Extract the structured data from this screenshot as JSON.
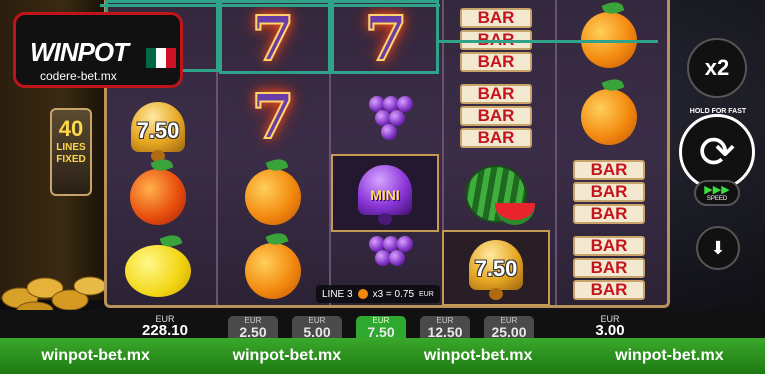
{
  "logo": {
    "brand": "WINPOT",
    "url": "codere-bet.mx",
    "flag_colors": [
      "#006847",
      "#ffffff",
      "#ce1126"
    ]
  },
  "lines": {
    "count": "40",
    "label1": "LINES",
    "label2": "FIXED"
  },
  "reels": [
    [
      "seven-symbol",
      "bell-symbol",
      "orange-symbol",
      "lemon-symbol"
    ],
    [
      "seven-symbol",
      "seven-symbol",
      "orange-symbol",
      "orange-symbol"
    ],
    [
      "seven-symbol",
      "grapes-symbol",
      "mini-bell-symbol",
      "grapes-symbol"
    ],
    [
      "bar-symbol",
      "bar-symbol",
      "watermelon-symbol",
      "bell-symbol"
    ],
    [
      "orange-symbol",
      "orange-symbol",
      "bar-symbol",
      "bar-symbol"
    ]
  ],
  "symbols": {
    "seven": "7",
    "bar": "BAR",
    "bell_value_1": "7.50",
    "bell_value_2": "7.50",
    "mini": "MINI"
  },
  "controls": {
    "multiplier": "x2",
    "hold_text": "HOLD FOR FAST PLAY",
    "speed_label": "SPEED",
    "speed_icon": "fast-forward-icon",
    "spin_icon": "spin-arrows-icon",
    "download_icon": "download-icon"
  },
  "line_info": {
    "line": "LINE 3",
    "calc": "x3 = 0.75",
    "currency": "EUR"
  },
  "credit": {
    "label": "EUR",
    "value": "228.10"
  },
  "bets": [
    {
      "label": "EUR",
      "value": "2.50",
      "active": false
    },
    {
      "label": "EUR",
      "value": "5.00",
      "active": false
    },
    {
      "label": "EUR",
      "value": "7.50",
      "active": true
    },
    {
      "label": "EUR",
      "value": "12.50",
      "active": false
    },
    {
      "label": "EUR",
      "value": "25.00",
      "active": false
    }
  ],
  "win": {
    "label": "EUR",
    "value": "3.00"
  },
  "watermark": [
    "winpot-bet.mx",
    "winpot-bet.mx",
    "winpot-bet.mx",
    "winpot-bet.mx"
  ],
  "colors": {
    "accent": "#2fa38a",
    "active_bet": "#2fa830",
    "band": "#3aa82a"
  }
}
